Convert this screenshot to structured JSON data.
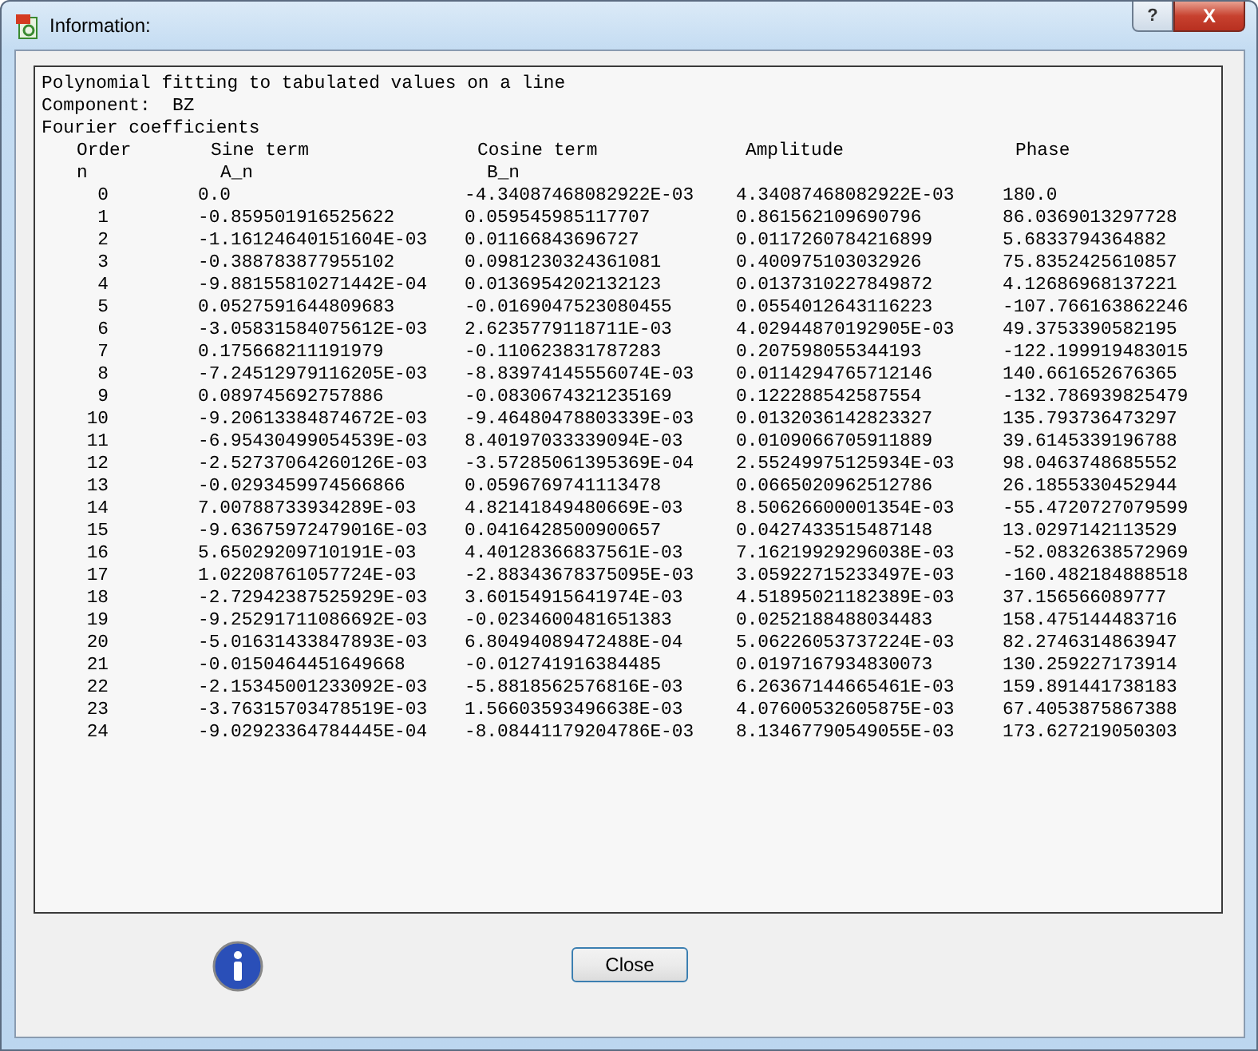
{
  "window": {
    "title": "Information:",
    "help_button": "?",
    "close_button": "X"
  },
  "report": {
    "lines": [
      "Polynomial fitting to tabulated values on a line",
      "Component:  BZ",
      "Fourier coefficients"
    ],
    "columns": [
      "Order",
      "Sine term",
      "Cosine term",
      "Amplitude",
      "Phase"
    ],
    "subheaders": [
      "n",
      "A_n",
      "B_n"
    ],
    "rows": [
      [
        "0",
        "0.0",
        "-4.34087468082922E-03",
        "4.34087468082922E-03",
        "180.0"
      ],
      [
        "1",
        "-0.859501916525622",
        "0.059545985117707",
        "0.861562109690796",
        "86.0369013297728"
      ],
      [
        "2",
        "-1.16124640151604E-03",
        "0.01166843696727",
        "0.0117260784216899",
        "5.6833794364882"
      ],
      [
        "3",
        "-0.388783877955102",
        "0.0981230324361081",
        "0.400975103032926",
        "75.8352425610857"
      ],
      [
        "4",
        "-9.88155810271442E-04",
        "0.0136954202132123",
        "0.0137310227849872",
        "4.12686968137221"
      ],
      [
        "5",
        "0.0527591644809683",
        "-0.0169047523080455",
        "0.0554012643116223",
        "-107.766163862246"
      ],
      [
        "6",
        "-3.05831584075612E-03",
        "2.6235779118711E-03",
        "4.02944870192905E-03",
        "49.3753390582195"
      ],
      [
        "7",
        "0.175668211191979",
        "-0.110623831787283",
        "0.207598055344193",
        "-122.199919483015"
      ],
      [
        "8",
        "-7.24512979116205E-03",
        "-8.83974145556074E-03",
        "0.0114294765712146",
        "140.661652676365"
      ],
      [
        "9",
        "0.089745692757886",
        "-0.0830674321235169",
        "0.122288542587554",
        "-132.786939825479"
      ],
      [
        "10",
        "-9.20613384874672E-03",
        "-9.46480478803339E-03",
        "0.0132036142823327",
        "135.793736473297"
      ],
      [
        "11",
        "-6.95430499054539E-03",
        "8.40197033339094E-03",
        "0.0109066705911889",
        "39.6145339196788"
      ],
      [
        "12",
        "-2.52737064260126E-03",
        "-3.57285061395369E-04",
        "2.55249975125934E-03",
        "98.0463748685552"
      ],
      [
        "13",
        "-0.0293459974566866",
        "0.0596769741113478",
        "0.0665020962512786",
        "26.1855330452944"
      ],
      [
        "14",
        "7.00788733934289E-03",
        "4.82141849480669E-03",
        "8.50626600001354E-03",
        "-55.4720727079599"
      ],
      [
        "15",
        "-9.63675972479016E-03",
        "0.0416428500900657",
        "0.0427433515487148",
        "13.0297142113529"
      ],
      [
        "16",
        "5.65029209710191E-03",
        "4.40128366837561E-03",
        "7.16219929296038E-03",
        "-52.0832638572969"
      ],
      [
        "17",
        "1.02208761057724E-03",
        "-2.88343678375095E-03",
        "3.05922715233497E-03",
        "-160.482184888518"
      ],
      [
        "18",
        "-2.72942387525929E-03",
        "3.60154915641974E-03",
        "4.51895021182389E-03",
        "37.156566089777"
      ],
      [
        "19",
        "-9.25291711086692E-03",
        "-0.0234600481651383",
        "0.0252188488034483",
        "158.475144483716"
      ],
      [
        "20",
        "-5.01631433847893E-03",
        "6.80494089472488E-04",
        "5.06226053737224E-03",
        "82.2746314863947"
      ],
      [
        "21",
        "-0.0150464451649668",
        "-0.012741916384485",
        "0.0197167934830073",
        "130.259227173914"
      ],
      [
        "22",
        "-2.15345001233092E-03",
        "-5.8818562576816E-03",
        "6.26367144665461E-03",
        "159.891441738183"
      ],
      [
        "23",
        "-3.76315703478519E-03",
        "1.56603593496638E-03",
        "4.07600532605875E-03",
        "67.4053875867388"
      ],
      [
        "24",
        "-9.02923364784445E-04",
        "-8.08441179204786E-03",
        "8.13467790549055E-03",
        "173.627219050303"
      ]
    ]
  },
  "buttons": [
    "Close"
  ]
}
